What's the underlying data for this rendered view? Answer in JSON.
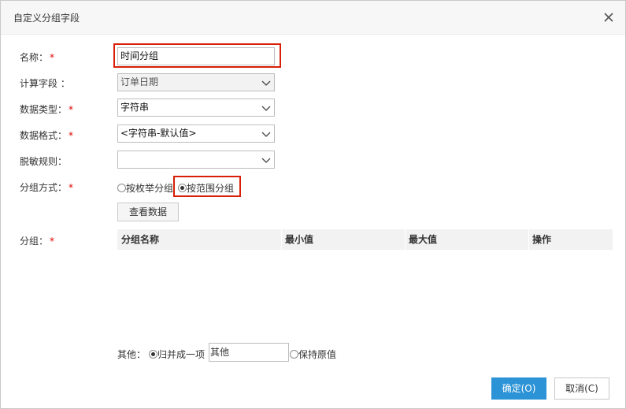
{
  "dialog": {
    "title": "自定义分组字段",
    "close_icon": "close-icon"
  },
  "form": {
    "name_label": "名称：",
    "name_value": "时间分组",
    "calc_label": "计算字段 ：",
    "calc_value": "订单日期",
    "dtype_label": "数据类型：",
    "dtype_value": "字符串",
    "dformat_label": "数据格式：",
    "dformat_value": "<字符串-默认值>",
    "mask_label": "脱敏规则：",
    "mask_value": "",
    "group_mode_label": "分组方式：",
    "group_mode_options": [
      {
        "label": "按枚举分组",
        "selected": false
      },
      {
        "label": "按范围分组",
        "selected": true
      }
    ],
    "view_data_button": "查看数据",
    "group_label": "分组：",
    "required_mark": "*"
  },
  "grid": {
    "columns": [
      "分组名称",
      "最小值",
      "最大值",
      "操作"
    ],
    "rows": []
  },
  "other": {
    "label": "其他：",
    "merge_option": "归并成一项",
    "merge_selected": true,
    "merge_value": "其他",
    "keep_option": "保持原值",
    "keep_selected": false
  },
  "footer": {
    "ok_label": "确定(O)",
    "cancel_label": "取消(C)"
  },
  "colors": {
    "primary": "#2c93d6",
    "highlight_box": "#d81e06",
    "required": "#e00000"
  }
}
